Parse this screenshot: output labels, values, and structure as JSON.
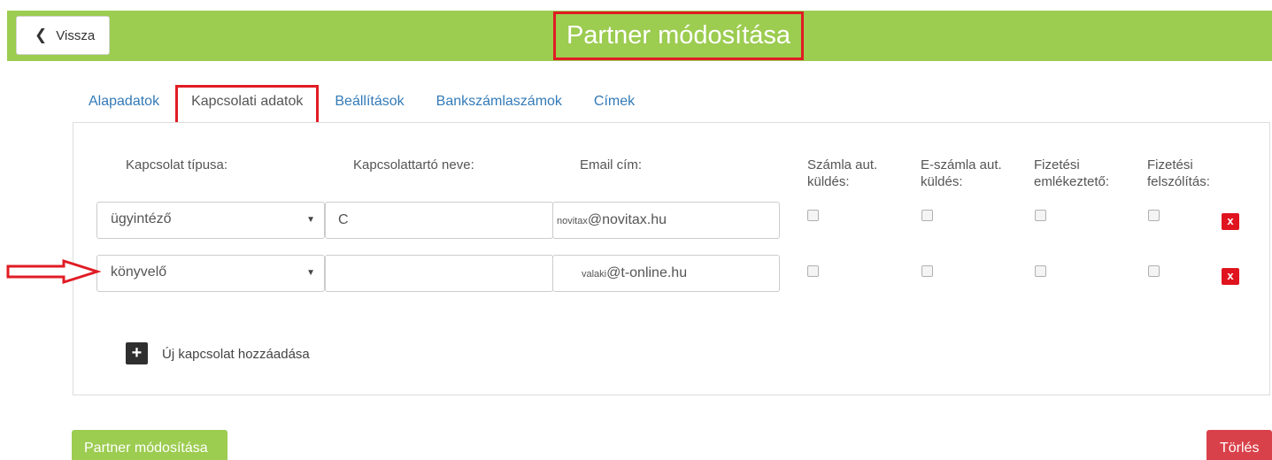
{
  "header": {
    "back_label": "Vissza",
    "title": "Partner módosítása",
    "back_icon": "chevron-left-icon"
  },
  "tabs": [
    {
      "label": "Alapadatok",
      "active": false
    },
    {
      "label": "Kapcsolati adatok",
      "active": true
    },
    {
      "label": "Beállítások",
      "active": false
    },
    {
      "label": "Bankszámlaszámok",
      "active": false
    },
    {
      "label": "Címek",
      "active": false
    }
  ],
  "contacts": {
    "columns": {
      "type": "Kapcsolat típusa:",
      "name": "Kapcsolattartó neve:",
      "email": "Email cím:",
      "invoice_send_1": "Számla aut.",
      "invoice_send_2": "küldés:",
      "einvoice_send_1": "E-számla aut.",
      "einvoice_send_2": "küldés:",
      "reminder_1": "Fizetési",
      "reminder_2": "emlékeztető:",
      "demand_1": "Fizetési",
      "demand_2": "felszólítás:"
    },
    "rows": [
      {
        "type": "ügyintéző",
        "name": "C",
        "email_user": "novitax",
        "email_domain": "@novitax.hu",
        "invoice_send": false,
        "einvoice_send": false,
        "reminder": false,
        "demand": false,
        "delete_label": "x"
      },
      {
        "type": "könyvelő",
        "name": "",
        "email_user": "valaki",
        "email_domain": "@t-online.hu",
        "invoice_send": false,
        "einvoice_send": false,
        "reminder": false,
        "demand": false,
        "delete_label": "x"
      }
    ],
    "add_icon": "+",
    "add_label": "Új kapcsolat hozzáadása"
  },
  "footer": {
    "save_label": "Partner módosítása",
    "delete_label": "Törlés"
  },
  "colors": {
    "header_green": "#9ccc50",
    "highlight_red": "#e01c24",
    "link_blue": "#337ab7",
    "delete_red": "#d9414a"
  }
}
